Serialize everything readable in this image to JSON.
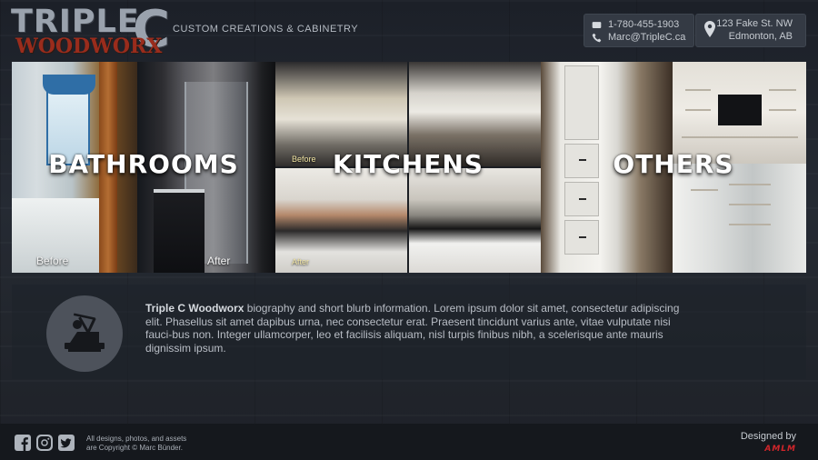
{
  "header": {
    "logo": {
      "line1": "TRIPLE",
      "big_letter": "C",
      "line2": "WOODWORX"
    },
    "tagline": "CUSTOM CREATIONS & CABINETRY",
    "contact": {
      "phone": "1-780-455-1903",
      "email": "Marc@TripleC.ca",
      "address_line1": "123 Fake St. NW",
      "address_line2": "Edmonton, AB"
    }
  },
  "categories": [
    {
      "title": "BATHROOMS",
      "captions": [
        "Before",
        "After"
      ]
    },
    {
      "title": "KITCHENS",
      "captions": [
        "Before",
        "After"
      ]
    },
    {
      "title": "OTHERS"
    }
  ],
  "bio": {
    "company": "Triple C Woodworx",
    "text": " biography and short blurb information. Lorem ipsum dolor sit amet, consectetur adipiscing elit. Phasellus sit amet dapibus urna, nec consectetur erat. Praesent tincidunt varius ante, vitae vulputate nisi fauci-bus non. Integer ullamcorper, leo et facilisis aliquam, nisl turpis finibus nibh, a scelerisque ante mauris dignissim ipsum."
  },
  "footer": {
    "social": [
      "facebook-icon",
      "instagram-icon",
      "twitter-icon"
    ],
    "copyright_line1": "All designs, photos, and assets",
    "copyright_line2": "are Copyright © Marc Bünder.",
    "designed_by": "Designed by",
    "designer_mark": "AMLM"
  },
  "colors": {
    "background": "#22262d",
    "panel": "#343a44",
    "logo_gray": "#9aa2ad",
    "logo_red": "#9a2c1c",
    "designer_red": "#d0252a"
  }
}
